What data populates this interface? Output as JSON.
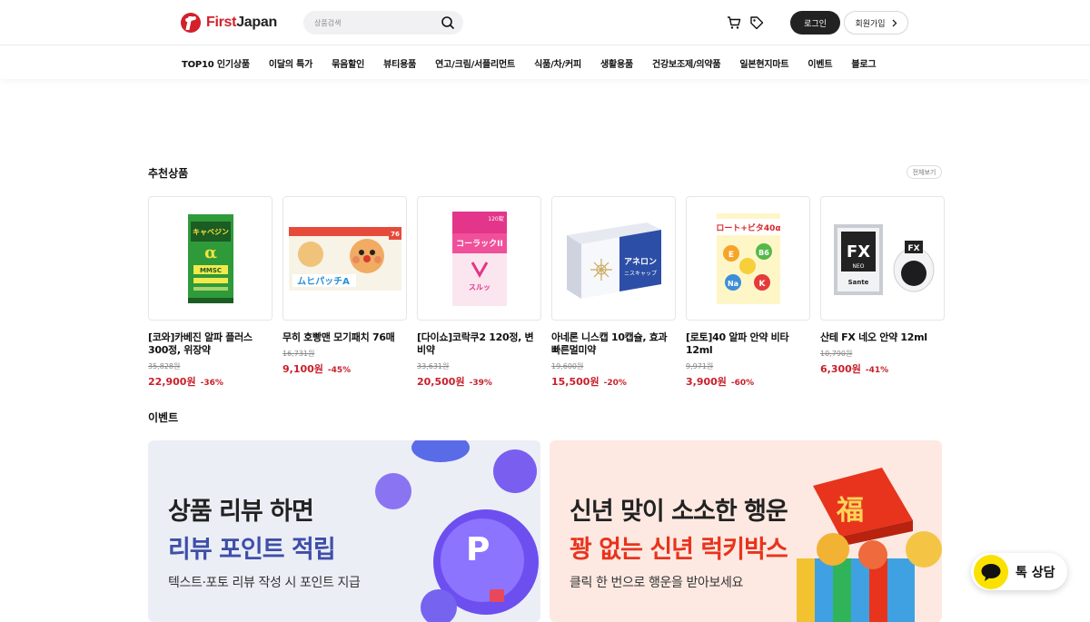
{
  "header": {
    "logo_first": "First",
    "logo_second": "Japan",
    "search_placeholder": "상품검색",
    "login_label": "로그인",
    "signup_label": "회원가입"
  },
  "nav": {
    "items": [
      "TOP10 인기상품",
      "이달의 특가",
      "묶음할인",
      "뷰티용품",
      "연고/크림/서플리먼트",
      "식품/차/커피",
      "생활용품",
      "건강보조제/의약품",
      "일본현지마트",
      "이벤트",
      "블로그"
    ]
  },
  "recommended": {
    "title": "추천상품",
    "more_label": "전체보기",
    "products": [
      {
        "name": "[코와]카베진 알파 플러스 300정, 위장약",
        "original_price": "35,828원",
        "price": "22,900원",
        "discount": "-36%",
        "pkg_text_1": "キャベジン",
        "pkg_text_2": "α",
        "pkg_text_3": "MMSC"
      },
      {
        "name": "무히 호빵맨 모기패치 76매",
        "original_price": "16,731원",
        "price": "9,100원",
        "discount": "-45%",
        "pkg_text_1": "ムヒパッチA",
        "pkg_text_2": "76"
      },
      {
        "name": "[다이쇼]코락쿠2 120정, 변비약",
        "original_price": "33,631원",
        "price": "20,500원",
        "discount": "-39%",
        "pkg_text_1": "コーラックII",
        "pkg_text_2": "120錠",
        "pkg_text_3": "スルッ"
      },
      {
        "name": "아네론 니스캡 10캡슐, 효과빠른멀미약",
        "original_price": "19,600원",
        "price": "15,500원",
        "discount": "-20%",
        "pkg_text_1": "アネロン",
        "pkg_text_2": "ニスキャップ"
      },
      {
        "name": "[로토]40 알파 안약 비타 12ml",
        "original_price": "9,971원",
        "price": "3,900원",
        "discount": "-60%",
        "pkg_text_1": "ロート+ビタ40α"
      },
      {
        "name": "산테 FX 네오 안약 12ml",
        "original_price": "10,790원",
        "price": "6,300원",
        "discount": "-41%",
        "pkg_text_1": "FX",
        "pkg_text_2": "NEO",
        "pkg_text_3": "Sante"
      }
    ]
  },
  "events": {
    "title": "이벤트",
    "banners": [
      {
        "line1": "상품 리뷰 하면",
        "line2": "리뷰 포인트 적립",
        "sub": "텍스트·포토 리뷰 작성 시 포인트 지급",
        "accent": "#3e4fa8",
        "badge": "P"
      },
      {
        "line1": "신년 맞이 소소한 행운",
        "line2": "꽝 없는 신년 럭키박스",
        "sub": "클릭 한 번으로 행운을 받아보세요",
        "accent": "#e8341c",
        "badge": "福"
      }
    ]
  },
  "chat": {
    "label": "톡 상담"
  },
  "colors": {
    "brand": "#d3202a",
    "sale": "#c8202a",
    "kakao": "#fae100"
  }
}
